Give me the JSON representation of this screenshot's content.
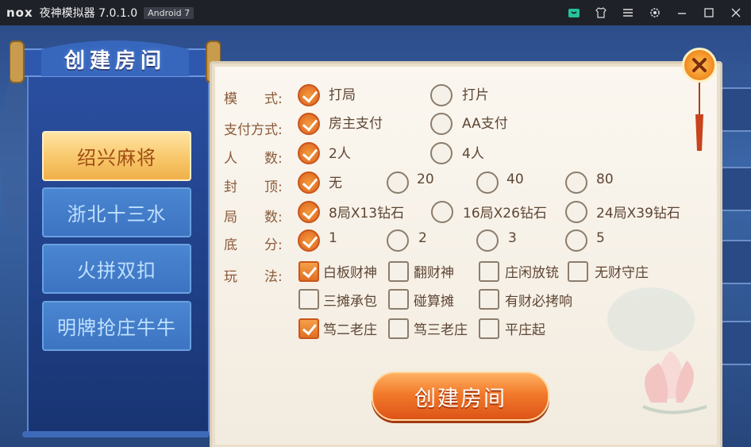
{
  "window": {
    "logo": "nox",
    "title": "夜神模拟器 7.0.1.0",
    "android_badge": "Android 7",
    "icons": [
      "store-icon",
      "skin-icon",
      "menu-icon",
      "settings-icon",
      "minimize-icon",
      "maximize-icon",
      "close-icon"
    ]
  },
  "panel": {
    "title": "创建房间",
    "tabs": [
      {
        "label": "绍兴麻将",
        "active": true
      },
      {
        "label": "浙北十三水",
        "active": false
      },
      {
        "label": "火拼双扣",
        "active": false
      },
      {
        "label": "明牌抢庄牛牛",
        "active": false
      }
    ]
  },
  "form": {
    "mode": {
      "label": "模　　式:",
      "options": [
        {
          "text": "打局",
          "checked": true
        },
        {
          "text": "打片",
          "checked": false
        }
      ]
    },
    "payment": {
      "label": "支付方式:",
      "options": [
        {
          "text": "房主支付",
          "checked": true
        },
        {
          "text": "AA支付",
          "checked": false
        }
      ]
    },
    "players": {
      "label": "人　　数:",
      "options": [
        {
          "text": "2人",
          "checked": true
        },
        {
          "text": "4人",
          "checked": false
        }
      ]
    },
    "cap": {
      "label": "封　　顶:",
      "options": [
        {
          "text": "无",
          "checked": true
        },
        {
          "text": "20",
          "checked": false
        },
        {
          "text": "40",
          "checked": false
        },
        {
          "text": "80",
          "checked": false
        }
      ]
    },
    "rounds": {
      "label": "局　　数:",
      "options": [
        {
          "text": "8局X13钻石",
          "checked": true
        },
        {
          "text": "16局X26钻石",
          "checked": false
        },
        {
          "text": "24局X39钻石",
          "checked": false
        }
      ]
    },
    "base": {
      "label": "底　　分:",
      "options": [
        {
          "text": "1",
          "checked": true
        },
        {
          "text": "2",
          "checked": false
        },
        {
          "text": "3",
          "checked": false
        },
        {
          "text": "5",
          "checked": false
        }
      ]
    },
    "rules": {
      "label": "玩　　法:",
      "options": [
        {
          "text": "白板财神",
          "checked": true
        },
        {
          "text": "翻财神",
          "checked": false
        },
        {
          "text": "庄闲放铳",
          "checked": false
        },
        {
          "text": "无财守庄",
          "checked": false
        },
        {
          "text": "三摊承包",
          "checked": false
        },
        {
          "text": "碰算摊",
          "checked": false
        },
        {
          "text": "有财必拷响",
          "checked": false
        },
        {
          "text": "笃二老庄",
          "checked": true
        },
        {
          "text": "笃三老庄",
          "checked": false
        },
        {
          "text": "平庄起",
          "checked": false
        }
      ]
    }
  },
  "actions": {
    "create_label": "创建房间"
  },
  "colors": {
    "accent": "#e4742a",
    "paper": "#f6f1e8",
    "label": "#8a5a3a",
    "tab_active": "#f8c76a",
    "tab_inactive": "#3d74c2"
  }
}
